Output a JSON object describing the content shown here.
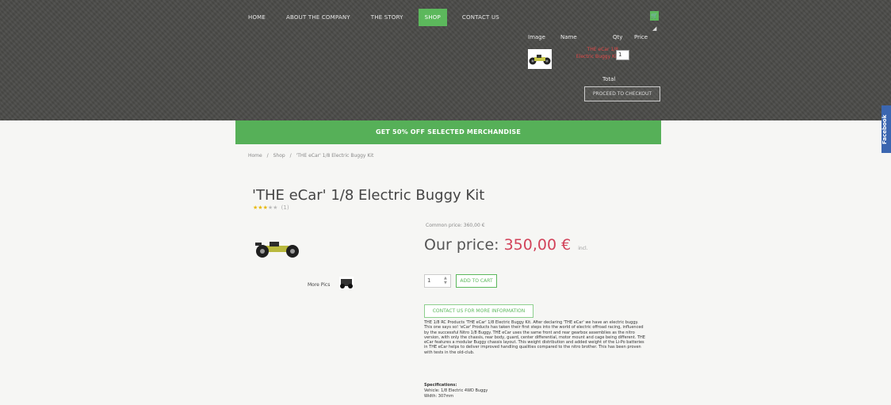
{
  "nav": {
    "items": [
      {
        "label": "HOME",
        "active": false
      },
      {
        "label": "ABOUT THE COMPANY",
        "active": false
      },
      {
        "label": "THE STORY",
        "active": false
      },
      {
        "label": "SHOP",
        "active": true
      },
      {
        "label": "CONTACT US",
        "active": false
      }
    ]
  },
  "cart": {
    "headers": {
      "image": "Image",
      "name": "Name",
      "qty": "Qty",
      "price": "Price"
    },
    "item": {
      "name_line1": "THE eCar 1/8",
      "name_line2": "Electric Buggy Kit",
      "qty": "1"
    },
    "total_label": "Total",
    "checkout_label": "PROCEED TO CHECKOUT"
  },
  "promo": "GET 50% OFF SELECTED MERCHANDISE",
  "facebook_tab": "Facebook",
  "breadcrumb": [
    "Home",
    "/",
    "Shop",
    "/",
    "'THE eCar' 1/8 Electric Buggy Kit"
  ],
  "product": {
    "title": "'THE eCar' 1/8 Electric Buggy Kit",
    "rating": 3,
    "rating_max": 5,
    "rating_count": "(1)",
    "common_price": "Common price: 360,00 €",
    "price_label": "Our price:",
    "price_value": "350,00 €",
    "tax_note": "incl.",
    "thumbs_label": "More Pics",
    "qty": "1",
    "add_to_cart": "ADD TO CART",
    "contact_label": "CONTACT US FOR MORE INFORMATION",
    "description": "THE 1/8 RC Products 'THE eCar' 1/8 Electric Buggy Kit. After declaring 'THE eCar' we have an electric buggy. This one says so! 'eCar' Products has taken their first steps into the world of electric offroad racing, influenced by the successful Nitro 1/8 Buggy. THE eCar uses the same front and rear gearbox assemblies as the nitro version, with only the chassis, rear body, guard, center differential, motor mount and cage being different. THE eCar features a modular Buggy chassis layout. This weight distribution and added weight of the Li-Po batteries in THE eCar helps to deliver improved handling qualities compared to the nitro brother. This has been proven with tests in the old-club.",
    "spec_title": "Specifications:",
    "specs": [
      "Vehicle: 1/8 Electric 4WD Buggy",
      "Width: 307mm"
    ]
  },
  "colors": {
    "accent_green": "#5cb85c",
    "price_red": "#d2435a",
    "header_bg": "#4b4b48",
    "facebook_blue": "#3b66b0"
  }
}
